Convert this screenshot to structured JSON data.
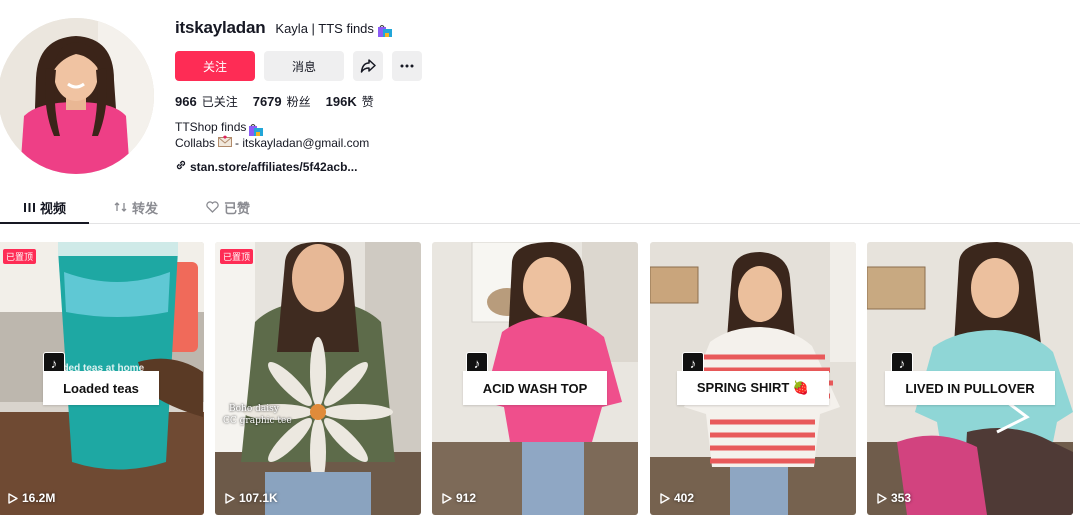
{
  "profile": {
    "username": "itskayladan",
    "nickname": "Kayla | TTS finds",
    "follow_label": "关注",
    "message_label": "消息",
    "stats": [
      {
        "value": "966",
        "label": "已关注"
      },
      {
        "value": "7679",
        "label": "粉丝"
      },
      {
        "value": "196K",
        "label": "赞"
      }
    ],
    "bio_line1": "TTShop finds",
    "bio_line2_prefix": "Collabs",
    "bio_line2_suffix": "- itskayladan@gmail.com",
    "link": "stan.store/affiliates/5f42acb..."
  },
  "tabs": [
    {
      "label": "视频",
      "icon": "grid-icon",
      "active": true
    },
    {
      "label": "转发",
      "icon": "repost-icon",
      "active": false
    },
    {
      "label": "已赞",
      "icon": "heart-outline-icon",
      "active": false
    }
  ],
  "videos": [
    {
      "caption": "Loaded teas",
      "views": "16.2M",
      "pinned": "已置顶",
      "faint": "loaded teas at home"
    },
    {
      "caption": "",
      "views": "107.1K",
      "pinned": "已置顶",
      "overlay_line1": "Boho daisy",
      "overlay_line2": "CC graphic tee"
    },
    {
      "caption": "ACID WASH TOP",
      "views": "912"
    },
    {
      "caption": "SPRING SHIRT 🍓",
      "views": "402"
    },
    {
      "caption": "LIVED IN PULLOVER",
      "views": "353"
    }
  ],
  "colors": {
    "accent": "#fe2c55",
    "button_grey": "#efeff0",
    "text": "#161823",
    "muted": "#8a8b91"
  }
}
